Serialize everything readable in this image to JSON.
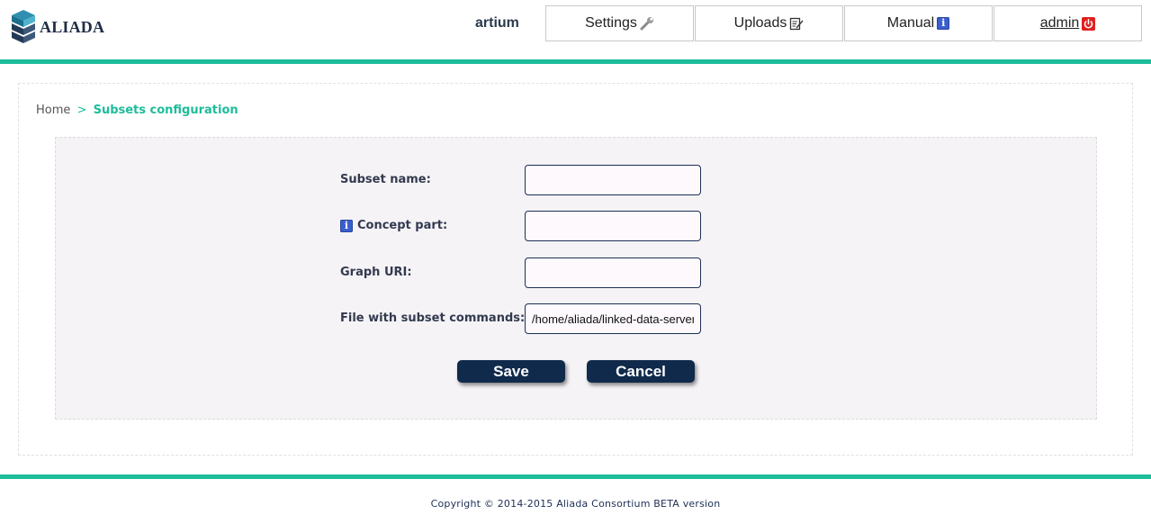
{
  "app": {
    "logo_text": "ALIADA",
    "user_name": "artium"
  },
  "nav": {
    "items": [
      {
        "label": "Settings",
        "icon": "wrench-icon"
      },
      {
        "label": "Uploads",
        "icon": "edit-icon"
      },
      {
        "label": "Manual",
        "icon": "info-icon"
      },
      {
        "label": "admin",
        "icon": "power-icon"
      }
    ]
  },
  "breadcrumb": {
    "home": "Home",
    "separator": ">",
    "current": "Subsets configuration"
  },
  "form": {
    "subset_name": {
      "label": "Subset name:",
      "value": ""
    },
    "concept_part": {
      "label": "Concept part:",
      "value": ""
    },
    "graph_uri": {
      "label": "Graph URI:",
      "value": ""
    },
    "file_commands": {
      "label": "File with subset commands:",
      "value": "/home/aliada/linked-data-server"
    }
  },
  "buttons": {
    "save": "Save",
    "cancel": "Cancel"
  },
  "footer": {
    "copyright": "Copyright © 2014-2015 Aliada Consortium BETA version"
  },
  "colors": {
    "accent": "#1ebc9a",
    "navy": "#102a4b",
    "info_blue": "#3a5fcd",
    "power_red": "#e02020"
  }
}
